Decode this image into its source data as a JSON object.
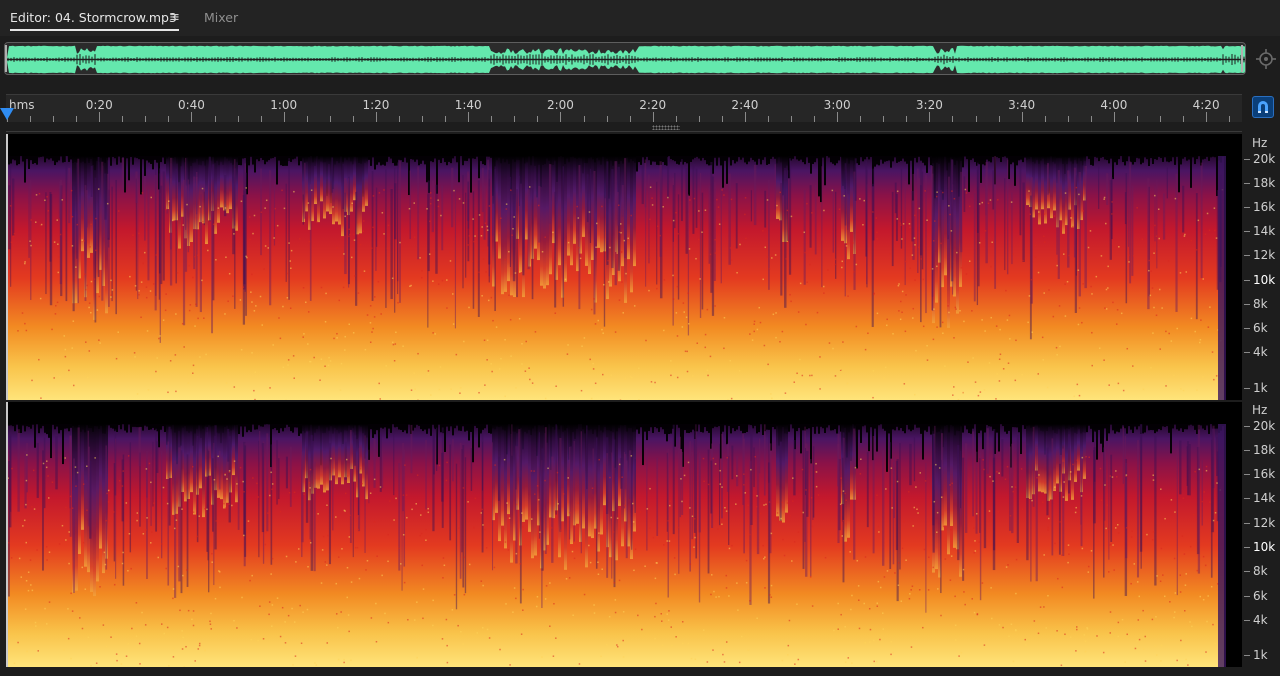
{
  "tabs": {
    "editor_label": "Editor: 04. Stormcrow.mp3",
    "menu_glyph": "≡",
    "mixer_label": "Mixer"
  },
  "colors": {
    "waveform": "#64e8ad",
    "playhead": "#2f8cf2",
    "spectrogram_low": "#000000",
    "spectrogram_mid": "#5a1a7a",
    "spectrogram_high": "#e8252b",
    "spectrogram_peak": "#ffe06a"
  },
  "ruler": {
    "unit_label": "hms",
    "labels": [
      "0:20",
      "0:40",
      "1:00",
      "1:20",
      "1:40",
      "2:00",
      "2:20",
      "2:40",
      "3:00",
      "3:20",
      "3:40",
      "4:00",
      "4:20"
    ]
  },
  "frequency_scale": {
    "unit_label": "Hz",
    "labels": [
      "20k",
      "18k",
      "16k",
      "14k",
      "12k",
      "10k",
      "8k",
      "6k",
      "4k",
      "1k"
    ],
    "bright_label": "10k"
  },
  "icons": {
    "overview_tool": "zoom-navigator-icon",
    "snap": "magnet-icon",
    "menu": "hamburger-menu-icon"
  }
}
